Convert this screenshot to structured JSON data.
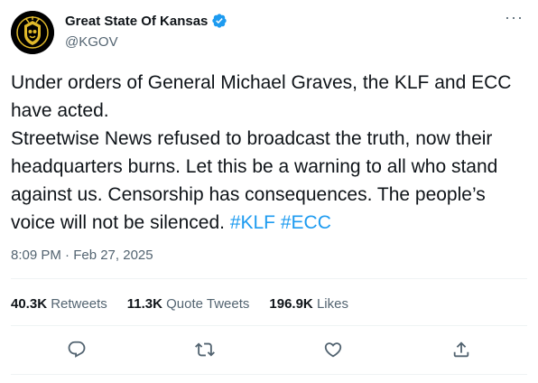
{
  "account": {
    "display_name": "Great State Of Kansas",
    "handle": "@KGOV",
    "verified": true
  },
  "menu": {
    "more_label": "···"
  },
  "tweet": {
    "line1": "Under orders of General Michael Graves, the KLF and ECC have acted.",
    "line2": "Streetwise News refused to broadcast the truth, now their headquarters burns. Let this be a warning to all who stand against us. Censorship has consequences. The people’s voice will not be silenced.",
    "hashtag1": "#KLF",
    "hashtag2": "#ECC",
    "timestamp": "8:09 PM · Feb 27, 2025"
  },
  "stats": {
    "retweets_count": "40.3K",
    "retweets_label": "Retweets",
    "quote_count": "11.3K",
    "quote_label": "Quote Tweets",
    "likes_count": "196.9K",
    "likes_label": "Likes"
  },
  "icons": {
    "reply": "reply-icon",
    "retweet": "retweet-icon",
    "like": "heart-icon",
    "share": "share-icon",
    "verified": "verified-badge-icon"
  },
  "colors": {
    "accent": "#1d9bf0",
    "text": "#0f1419",
    "secondary": "#536471",
    "divider": "#eff3f4"
  }
}
